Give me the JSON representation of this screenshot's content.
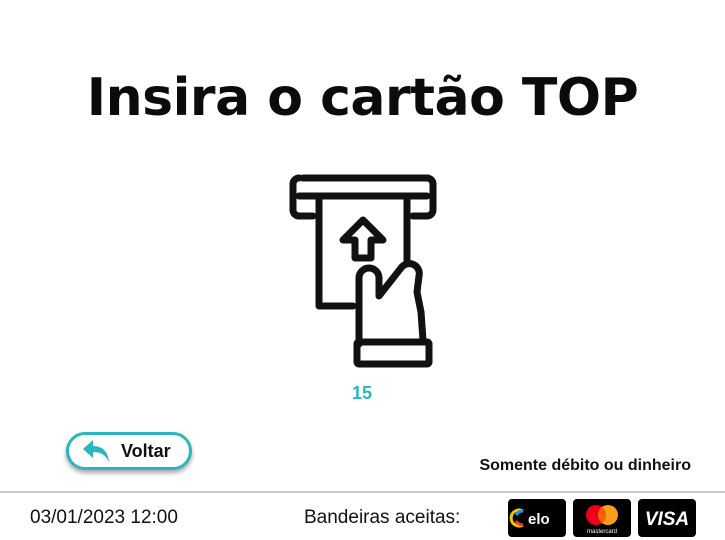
{
  "screen": {
    "title": "Insira o cartão TOP",
    "countdown": "15",
    "back_button_label": "Voltar",
    "payment_note": "Somente débito ou dinheiro"
  },
  "footer": {
    "datetime": "03/01/2023 12:00",
    "accepted_label": "Bandeiras aceitas:",
    "brands": [
      {
        "name": "elo",
        "icon": "elo-logo"
      },
      {
        "name": "mastercard",
        "icon": "mastercard-logo"
      },
      {
        "name": "VISA",
        "icon": "visa-logo"
      }
    ]
  },
  "colors": {
    "accent": "#2bb6bd",
    "text": "#111111",
    "divider": "#c9c9c9",
    "brand_bg": "#000000"
  }
}
